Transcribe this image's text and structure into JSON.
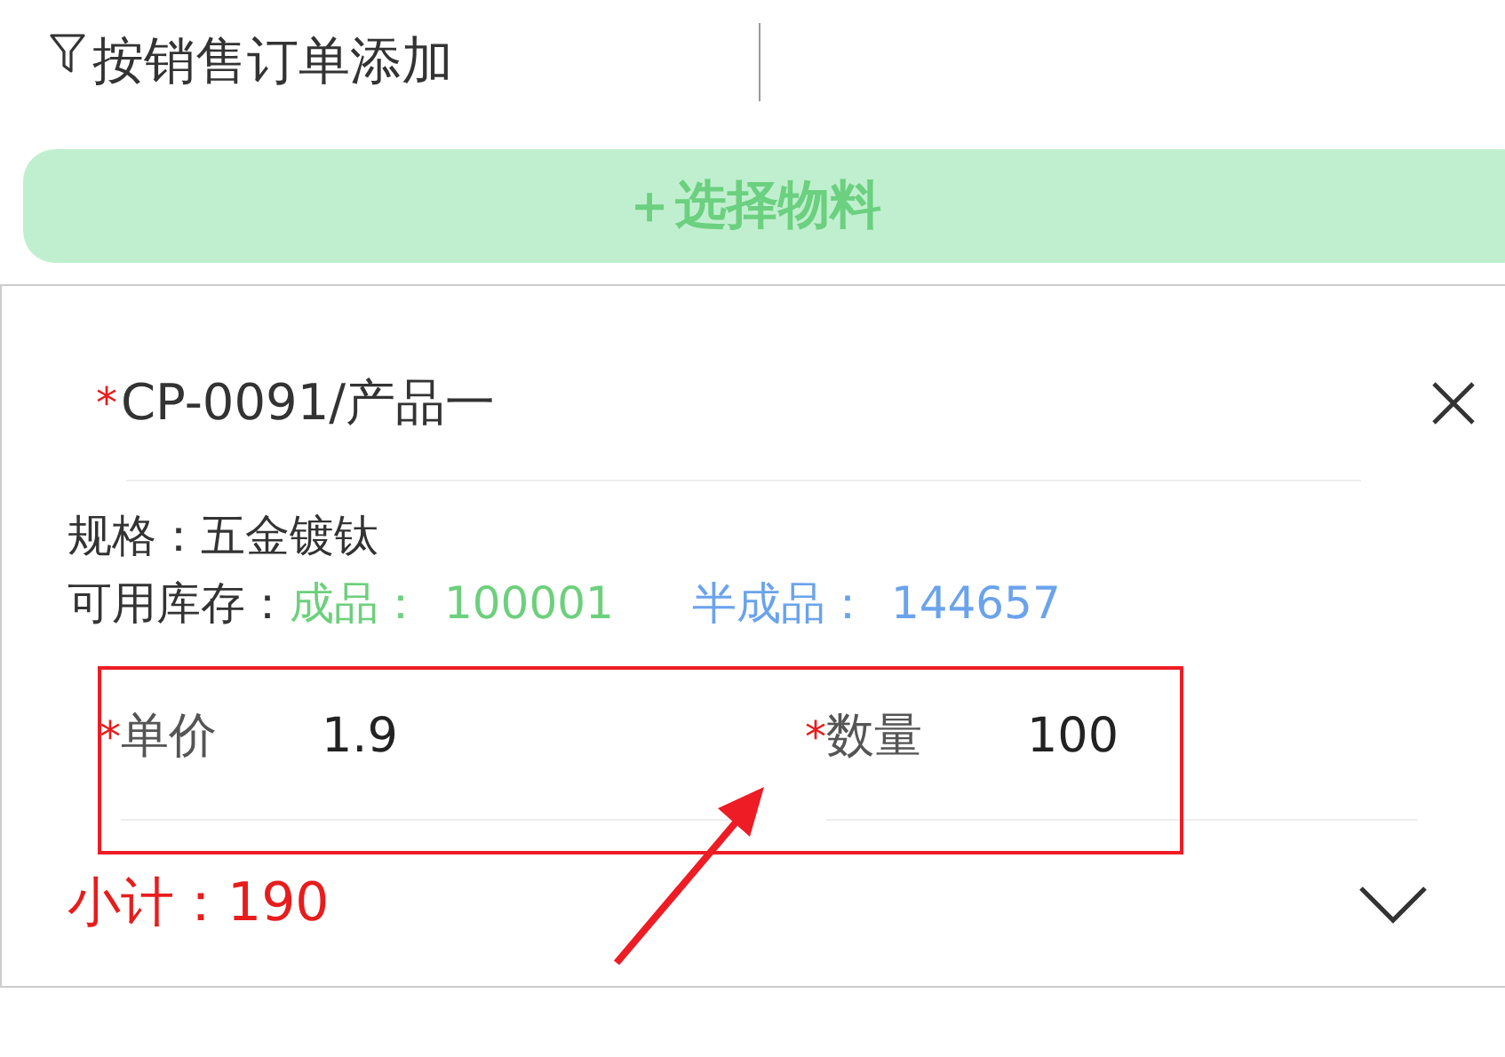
{
  "header": {
    "title": "按销售订单添加"
  },
  "add_button": {
    "label": "＋选择物料"
  },
  "item": {
    "required_mark": "*",
    "name": "CP-0091/产品一",
    "spec": "规格：五金镀钛",
    "stock_label": "可用库存：",
    "stock": [
      {
        "kind": "finished",
        "label": "成品：",
        "value": "100001"
      },
      {
        "kind": "semi",
        "label": "半成品：",
        "value": "144657"
      }
    ],
    "fields": [
      {
        "required_mark": "*",
        "label": "单价",
        "value": "1.9"
      },
      {
        "required_mark": "*",
        "label": "数量",
        "value": "100"
      }
    ],
    "subtotal": "小计：190"
  }
}
